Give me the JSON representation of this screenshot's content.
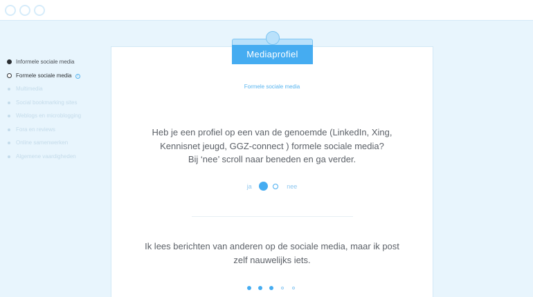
{
  "window": {
    "controls": [
      "circle",
      "circle",
      "circle"
    ]
  },
  "sidebar": {
    "items": [
      {
        "label": "Informele sociale media",
        "state": "done"
      },
      {
        "label": "Formele sociale media",
        "state": "active",
        "info_icon": "info-icon"
      },
      {
        "label": "Multimedia",
        "state": "pending"
      },
      {
        "label": "Social bookmarking sites",
        "state": "pending"
      },
      {
        "label": "Weblogs en microblogging",
        "state": "pending"
      },
      {
        "label": "Fora en reviews",
        "state": "pending"
      },
      {
        "label": "Online samenwerken",
        "state": "pending"
      },
      {
        "label": "Algemene vaardigheden",
        "state": "pending"
      }
    ]
  },
  "card": {
    "tab_label": "Mediaprofiel",
    "subtitle": "Formele sociale media",
    "question_lines": [
      "Heb je een profiel op een van de genoemde (LinkedIn, Xing,",
      "Kennisnet jeugd, GGZ-connect ) formele sociale media?",
      "Bij ‘nee’ scroll naar beneden en ga verder."
    ],
    "answer_yes": "ja",
    "answer_no": "nee",
    "selected_answer": "ja",
    "statement_lines": [
      "Ik lees berichten van anderen op de sociale media, maar ik post",
      "zelf nauwelijks iets."
    ]
  },
  "pager": {
    "total": 5,
    "filled": 3
  },
  "colors": {
    "accent": "#45acf1",
    "background": "#e8f5fd",
    "tab_light": "#b9e1fb",
    "text": "#5b6067"
  }
}
